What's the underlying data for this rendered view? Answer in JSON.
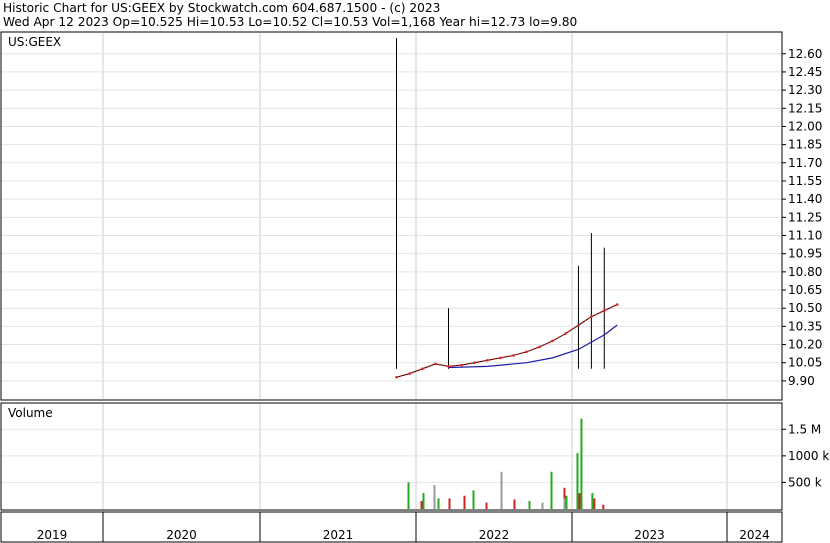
{
  "header": {
    "line1": "Historic Chart for US:GEEX by Stockwatch.com 604.687.1500 - (c) 2023",
    "line2": "Wed Apr 12 2023   Op=10.525  Hi=10.53  Lo=10.52  Cl=10.53  Vol=1,168  Year hi=12.73  lo=9.80"
  },
  "chart_data": [
    {
      "type": "candlestick",
      "title": "US:GEEX",
      "y_ticks": [
        "12.60",
        "12.45",
        "12.30",
        "12.15",
        "12.00",
        "11.85",
        "11.70",
        "11.55",
        "11.40",
        "11.25",
        "11.10",
        "10.95",
        "10.80",
        "10.65",
        "10.50",
        "10.35",
        "10.20",
        "10.05",
        "9.90"
      ],
      "ylim": [
        9.8,
        12.73
      ],
      "x_ticks": [
        "2019",
        "2020",
        "2021",
        "2022",
        "2023",
        "2024"
      ],
      "price_trend": {
        "dates": [
          "2021-11",
          "2021-12",
          "2022-01",
          "2022-02",
          "2022-03",
          "2022-04",
          "2022-05",
          "2022-06",
          "2022-07",
          "2022-08",
          "2022-09",
          "2022-10",
          "2022-11",
          "2022-12",
          "2023-01",
          "2023-02",
          "2023-03",
          "2023-04"
        ],
        "close": [
          9.93,
          9.96,
          10.0,
          10.04,
          10.02,
          10.03,
          10.05,
          10.07,
          10.09,
          10.11,
          10.14,
          10.18,
          10.23,
          10.29,
          10.36,
          10.43,
          10.48,
          10.53
        ]
      },
      "moving_average_blue": {
        "dates": [
          "2022-03",
          "2022-06",
          "2022-09",
          "2022-11",
          "2023-01",
          "2023-03",
          "2023-04"
        ],
        "values": [
          10.01,
          10.02,
          10.05,
          10.09,
          10.16,
          10.28,
          10.36
        ]
      },
      "spikes": [
        {
          "date": "2021-11",
          "high": 12.73
        },
        {
          "date": "2022-03",
          "high": 10.5
        },
        {
          "date": "2022-03",
          "high": 10.49
        },
        {
          "date": "2023-01",
          "high": 10.85
        },
        {
          "date": "2023-02",
          "high": 11.12
        },
        {
          "date": "2023-03",
          "high": 11.0
        }
      ],
      "grid": true
    },
    {
      "type": "bar",
      "title": "Volume",
      "y_ticks": [
        "1.5 M",
        "1000 k",
        "500 k"
      ],
      "ylim": [
        0,
        1900000
      ],
      "series": [
        {
          "color": "#22aa22",
          "dates": [
            "2021-12",
            "2022-01",
            "2022-02",
            "2022-05",
            "2022-07",
            "2022-09",
            "2022-11",
            "2022-12",
            "2023-01",
            "2023-01",
            "2023-02"
          ],
          "values": [
            500000,
            300000,
            200000,
            350000,
            200000,
            150000,
            700000,
            250000,
            1700000,
            1050000,
            300000
          ]
        },
        {
          "color": "#cc2222",
          "dates": [
            "2022-01",
            "2022-03",
            "2022-04",
            "2022-06",
            "2022-08",
            "2022-10",
            "2022-12",
            "2023-01",
            "2023-02",
            "2023-03"
          ],
          "values": [
            150000,
            200000,
            250000,
            120000,
            180000,
            100000,
            400000,
            300000,
            200000,
            80000
          ]
        },
        {
          "color": "#999999",
          "dates": [
            "2022-02",
            "2022-07",
            "2022-10",
            "2022-12"
          ],
          "values": [
            450000,
            700000,
            120000,
            200000
          ]
        }
      ]
    }
  ]
}
